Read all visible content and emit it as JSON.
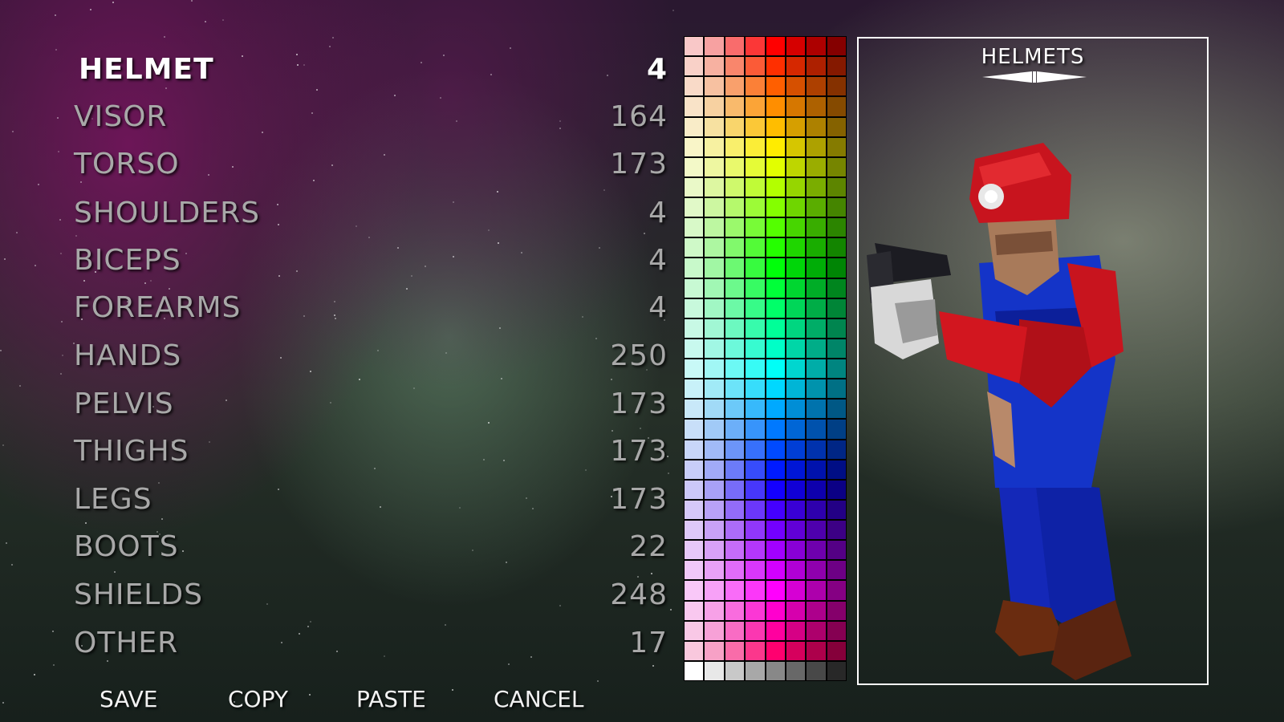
{
  "parts": [
    {
      "label": "HELMET",
      "value": "4",
      "selected": true
    },
    {
      "label": "VISOR",
      "value": "164"
    },
    {
      "label": "TORSO",
      "value": "173"
    },
    {
      "label": "SHOULDERS",
      "value": "4"
    },
    {
      "label": "BICEPS",
      "value": "4"
    },
    {
      "label": "FOREARMS",
      "value": "4"
    },
    {
      "label": "HANDS",
      "value": "250"
    },
    {
      "label": "PELVIS",
      "value": "173"
    },
    {
      "label": "THIGHS",
      "value": "173"
    },
    {
      "label": "LEGS",
      "value": "173"
    },
    {
      "label": "BOOTS",
      "value": "22"
    },
    {
      "label": "SHIELDS",
      "value": "248"
    },
    {
      "label": "OTHER",
      "value": "17"
    }
  ],
  "actions": {
    "save": "SAVE",
    "copy": "COPY",
    "paste": "PASTE",
    "cancel": "CANCEL"
  },
  "preview": {
    "title": "HELMETS",
    "arrows_icon": "left-right-arrows-icon"
  },
  "colors": {
    "selected_text": "#ffffff",
    "normal_text": "#a8a8a8",
    "armor_red": "#c8141e",
    "armor_blue": "#1030c8"
  }
}
